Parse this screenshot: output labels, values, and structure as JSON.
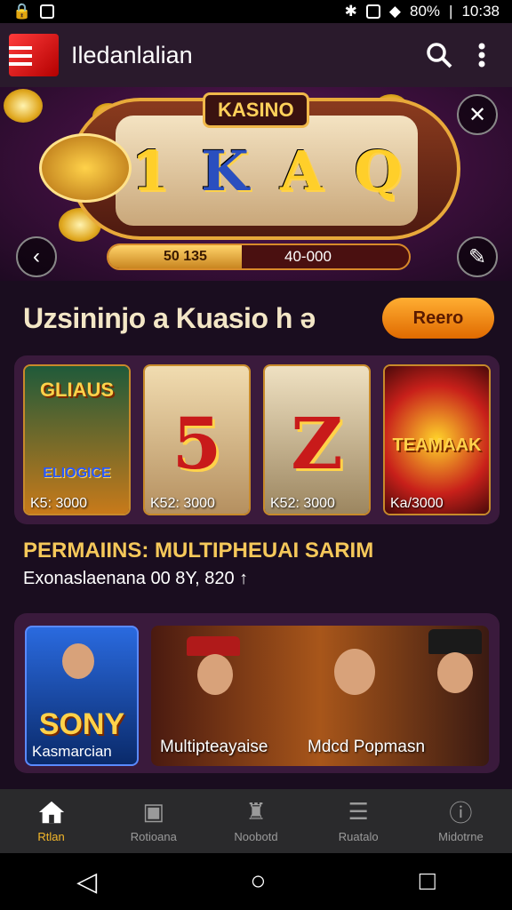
{
  "status_bar": {
    "battery_text": "80%",
    "time": "10:38"
  },
  "app_bar": {
    "title": "Iledanlalian",
    "icons": [
      "menu-icon",
      "search-icon",
      "more-vert-icon"
    ]
  },
  "hero": {
    "sign": "KASINO",
    "reel_symbols": [
      "1",
      "K",
      "A",
      "Q"
    ],
    "counter_left": "50 135",
    "counter_right": "40-000"
  },
  "section": {
    "title": "Uzsininjo a Kuasio h ə",
    "button": "Reero"
  },
  "games": [
    {
      "title": "GLIAUS",
      "subtitle": "ELIOGICE",
      "label": "K5: 3000"
    },
    {
      "symbol": "5",
      "label": "K52: 3000"
    },
    {
      "symbol": "Z",
      "label": "K52: 3000"
    },
    {
      "title": "TEAMAAK",
      "label": "Ka/3000"
    }
  ],
  "info": {
    "title": "PERMAIINS: MULTIPHEUAI SARIM",
    "subtitle": "Exonaslaenana 00 8Y, 820 ↑"
  },
  "features": {
    "left_title": "SONY",
    "left_label": "Kasmarcian",
    "mid_label": "Multipteayaise",
    "right_label": "Mdcd Popmasn"
  },
  "bottom_nav": [
    {
      "label": "Rtlan",
      "icon": "home-icon"
    },
    {
      "label": "Rotioana",
      "icon": "cards-icon"
    },
    {
      "label": "Noobotd",
      "icon": "castle-icon"
    },
    {
      "label": "Ruatalo",
      "icon": "list-icon"
    },
    {
      "label": "Midotrne",
      "icon": "info-icon"
    }
  ]
}
